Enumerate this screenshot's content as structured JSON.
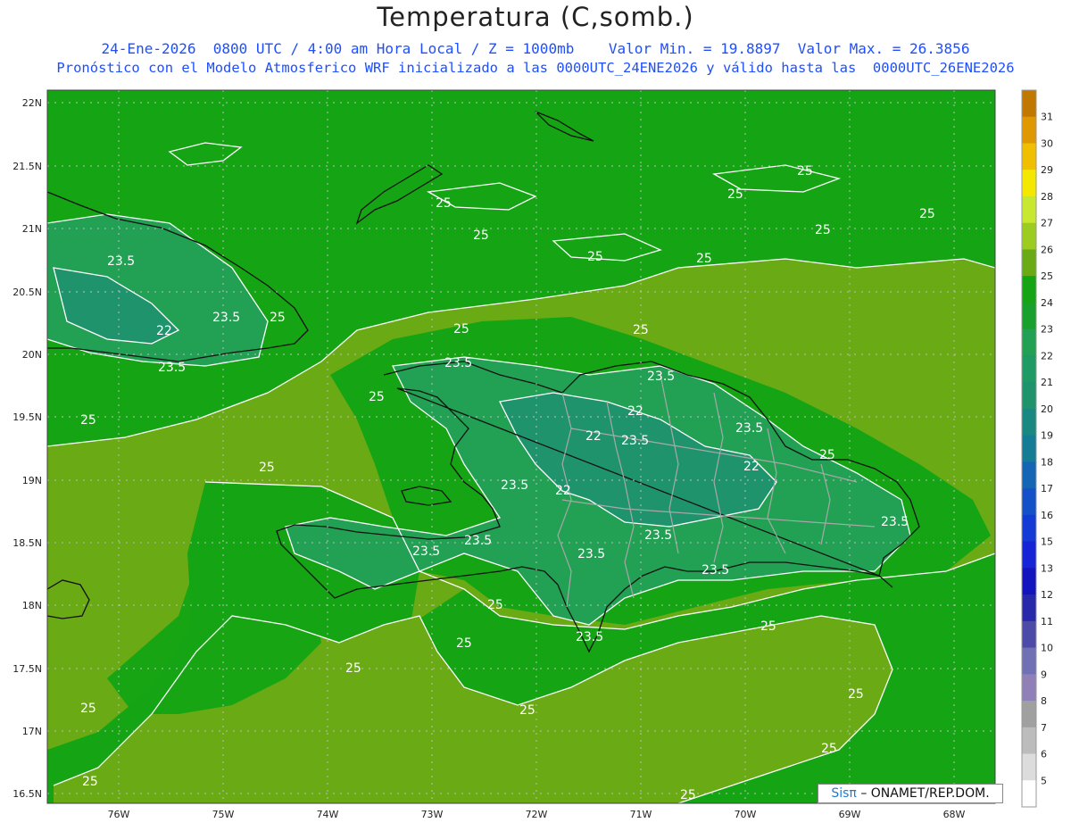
{
  "title": "Temperatura (C,somb.)",
  "subtitle_line1": "24-Ene-2026  0800 UTC / 4:00 am Hora Local / Z = 1000mb    Valor Min. = 19.8897  Valor Max. = 26.3856",
  "subtitle_line2": "Pronóstico con el Modelo Atmosferico WRF inicializado a las 0000UTC_24ENE2026 y válido hasta las  0000UTC_26ENE2026",
  "credit": {
    "brand": "Sisπ",
    "text": "– ONAMET/REP.DOM."
  },
  "map": {
    "lat_labels": [
      "22N",
      "21.5N",
      "21N",
      "20.5N",
      "20N",
      "19.5N",
      "19N",
      "18.5N",
      "18N",
      "17.5N",
      "17N",
      "16.5N"
    ],
    "lon_labels": [
      "76W",
      "75W",
      "74W",
      "73W",
      "72W",
      "71W",
      "70W",
      "69W",
      "68W"
    ],
    "contour_labels": [
      "25",
      "23.5",
      "22"
    ],
    "colors": {
      "field_25": "#6aaa14",
      "field_24": "#14a414",
      "field_23": "#22a054",
      "field_22": "#1f946c"
    }
  },
  "colorbar": {
    "ticks": [
      "31",
      "30",
      "29",
      "28",
      "27",
      "26",
      "25",
      "24",
      "23",
      "22",
      "21",
      "20",
      "19",
      "18",
      "17",
      "16",
      "15",
      "13",
      "12",
      "11",
      "10",
      "9",
      "8",
      "7",
      "6",
      "5"
    ],
    "colors": [
      "#c07800",
      "#e09800",
      "#f0c000",
      "#f4e800",
      "#c8e830",
      "#9ccc20",
      "#6aaa14",
      "#14a414",
      "#18a02c",
      "#22a054",
      "#1e9a64",
      "#1f946c",
      "#188880",
      "#147c94",
      "#1466b4",
      "#1450c8",
      "#143ad6",
      "#1424d6",
      "#1414be",
      "#2828aa",
      "#4c4ca8",
      "#7070b4",
      "#9080b8",
      "#a0a0a0",
      "#bcbcbc",
      "#dcdcdc",
      "#ffffff"
    ]
  }
}
